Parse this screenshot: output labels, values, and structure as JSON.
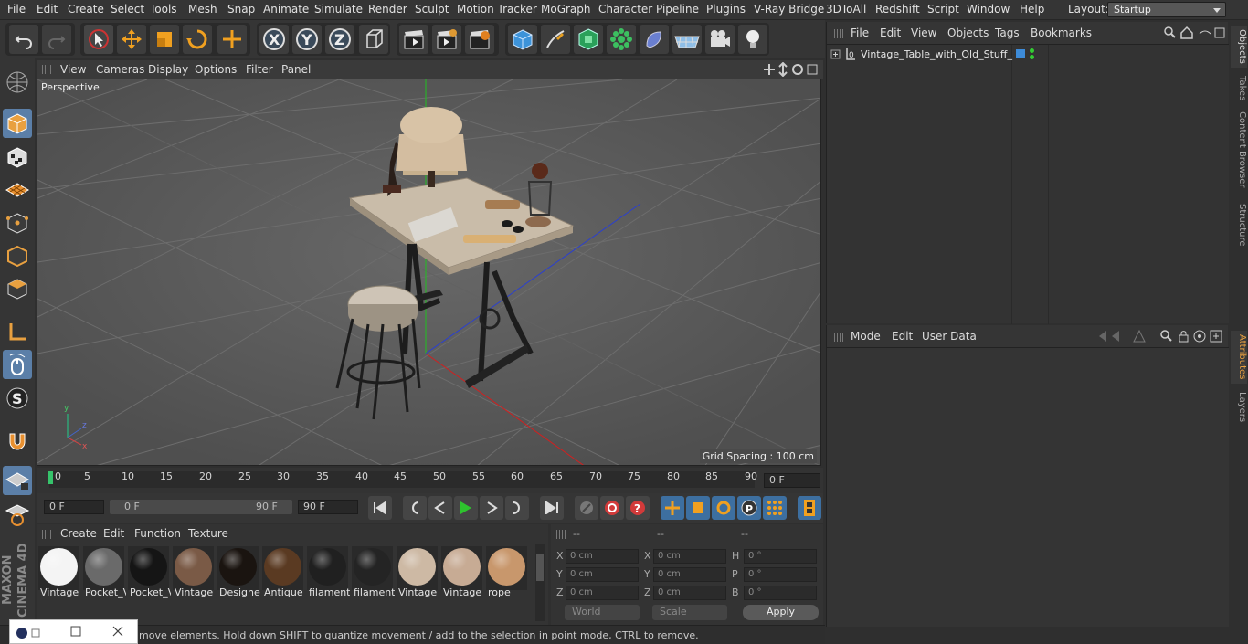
{
  "menu": {
    "items": [
      "File",
      "Edit",
      "Create",
      "Select",
      "Tools",
      "Mesh",
      "Snap",
      "Animate",
      "Simulate",
      "Render",
      "Sculpt",
      "Motion Tracker",
      "MoGraph",
      "Character",
      "Pipeline",
      "Plugins",
      "V-Ray Bridge",
      "3DToAll",
      "Redshift",
      "Script",
      "Window",
      "Help"
    ],
    "layout_label": "Layout:",
    "layout_value": "Startup"
  },
  "viewport": {
    "menu": [
      "View",
      "Cameras",
      "Display",
      "Options",
      "Filter",
      "Panel"
    ],
    "label": "Perspective",
    "grid_spacing": "Grid Spacing : 100 cm"
  },
  "timeline": {
    "ticks": [
      "0",
      "5",
      "10",
      "15",
      "20",
      "25",
      "30",
      "35",
      "40",
      "45",
      "50",
      "55",
      "60",
      "65",
      "70",
      "75",
      "80",
      "85",
      "90"
    ],
    "current_frame": "0 F"
  },
  "transport": {
    "start": "0 F",
    "range_start": "0 F",
    "range_end": "90 F",
    "end": "90 F"
  },
  "materials": {
    "menu": [
      "Create",
      "Edit",
      "Function",
      "Texture"
    ],
    "items": [
      {
        "label": "Vintage",
        "color": "#f4f4f4"
      },
      {
        "label": "Pocket_V",
        "color": "#6a6a6a"
      },
      {
        "label": "Pocket_V",
        "color": "#151515"
      },
      {
        "label": "Vintage",
        "color": "#7a5a46"
      },
      {
        "label": "Designe",
        "color": "#1a1410"
      },
      {
        "label": "Antique",
        "color": "#5a3a22"
      },
      {
        "label": "filament",
        "color": "#202020"
      },
      {
        "label": "filament",
        "color": "#242424"
      },
      {
        "label": "Vintage",
        "color": "#cdb9a4"
      },
      {
        "label": "Vintage",
        "color": "#c7ab94"
      },
      {
        "label": "rope",
        "color": "#c8976c"
      }
    ]
  },
  "coords": {
    "header": [
      "--",
      "--",
      "--"
    ],
    "rows": [
      {
        "a": "X",
        "av": "0 cm",
        "b": "X",
        "bv": "0 cm",
        "c": "H",
        "cv": "0 °"
      },
      {
        "a": "Y",
        "av": "0 cm",
        "b": "Y",
        "bv": "0 cm",
        "c": "P",
        "cv": "0 °"
      },
      {
        "a": "Z",
        "av": "0 cm",
        "b": "Z",
        "bv": "0 cm",
        "c": "B",
        "cv": "0 °"
      }
    ],
    "space": "World",
    "mode": "Scale",
    "apply": "Apply"
  },
  "objects": {
    "menu": [
      "File",
      "Edit",
      "View",
      "Objects",
      "Tags",
      "Bookmarks"
    ],
    "tree": [
      {
        "name": "Vintage_Table_with_Old_Stuff_"
      }
    ]
  },
  "attributes": {
    "menu": [
      "Mode",
      "Edit",
      "User Data"
    ]
  },
  "right_tabs": [
    "Objects",
    "Takes",
    "Content Browser",
    "Structure",
    "Attributes",
    "Layers"
  ],
  "status": "move elements. Hold down SHIFT to quantize movement / add to the selection in point mode, CTRL to remove.",
  "brand": "MAXON CINEMA 4D",
  "colors": {
    "accent": "#5b7fa8",
    "play": "#2ec32e",
    "record": "#d23a3a",
    "axis_x": "#b03030",
    "axis_y": "#30a030",
    "axis_z": "#3050c0"
  }
}
